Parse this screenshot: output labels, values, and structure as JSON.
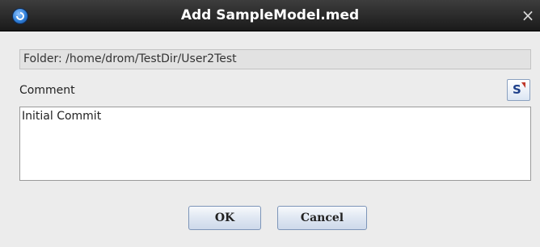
{
  "window": {
    "title": "Add SampleModel.med",
    "close_glyph": "×",
    "app_icon": "app-logo-icon"
  },
  "folder": {
    "text": "Folder: /home/drom/TestDir/User2Test"
  },
  "comment": {
    "label": "Comment",
    "value": "Initial Commit",
    "snippet_icon": "snippet-icon"
  },
  "buttons": {
    "ok_label": "OK",
    "cancel_label": "Cancel"
  },
  "colors": {
    "titlebar": "#1a1a1a",
    "dialog_bg": "#ececec",
    "button_border": "#7d95b8"
  }
}
